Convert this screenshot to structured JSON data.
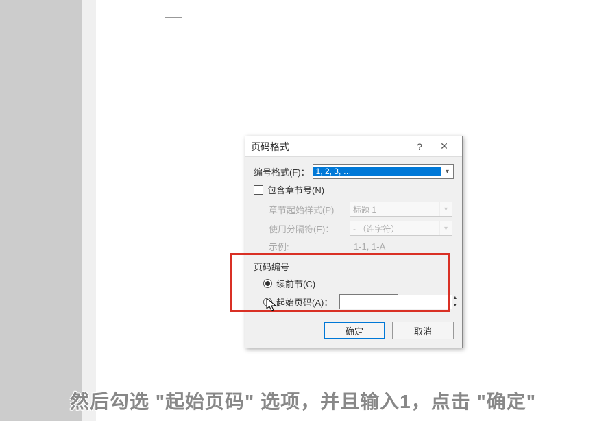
{
  "dialog": {
    "title": "页码格式",
    "help": "?",
    "close": "✕",
    "number_format_label": "编号格式(F)：",
    "number_format_value": "1, 2, 3, …",
    "include_chapter_label": "包含章节号(N)",
    "chapter_start_label": "章节起始样式(P)",
    "chapter_start_value": "标题 1",
    "separator_label": "使用分隔符(E)：",
    "separator_value": "- （连字符）",
    "example_label": "示例:",
    "example_value": "1-1, 1-A",
    "page_number_group": "页码编号",
    "continue_label": "续前节(C)",
    "start_at_label": "起始页码(A)：",
    "start_at_value": "",
    "ok": "确定",
    "cancel": "取消"
  },
  "subtitle": "然后勾选 \"起始页码\" 选项，并且输入1，点击 \"确定\""
}
